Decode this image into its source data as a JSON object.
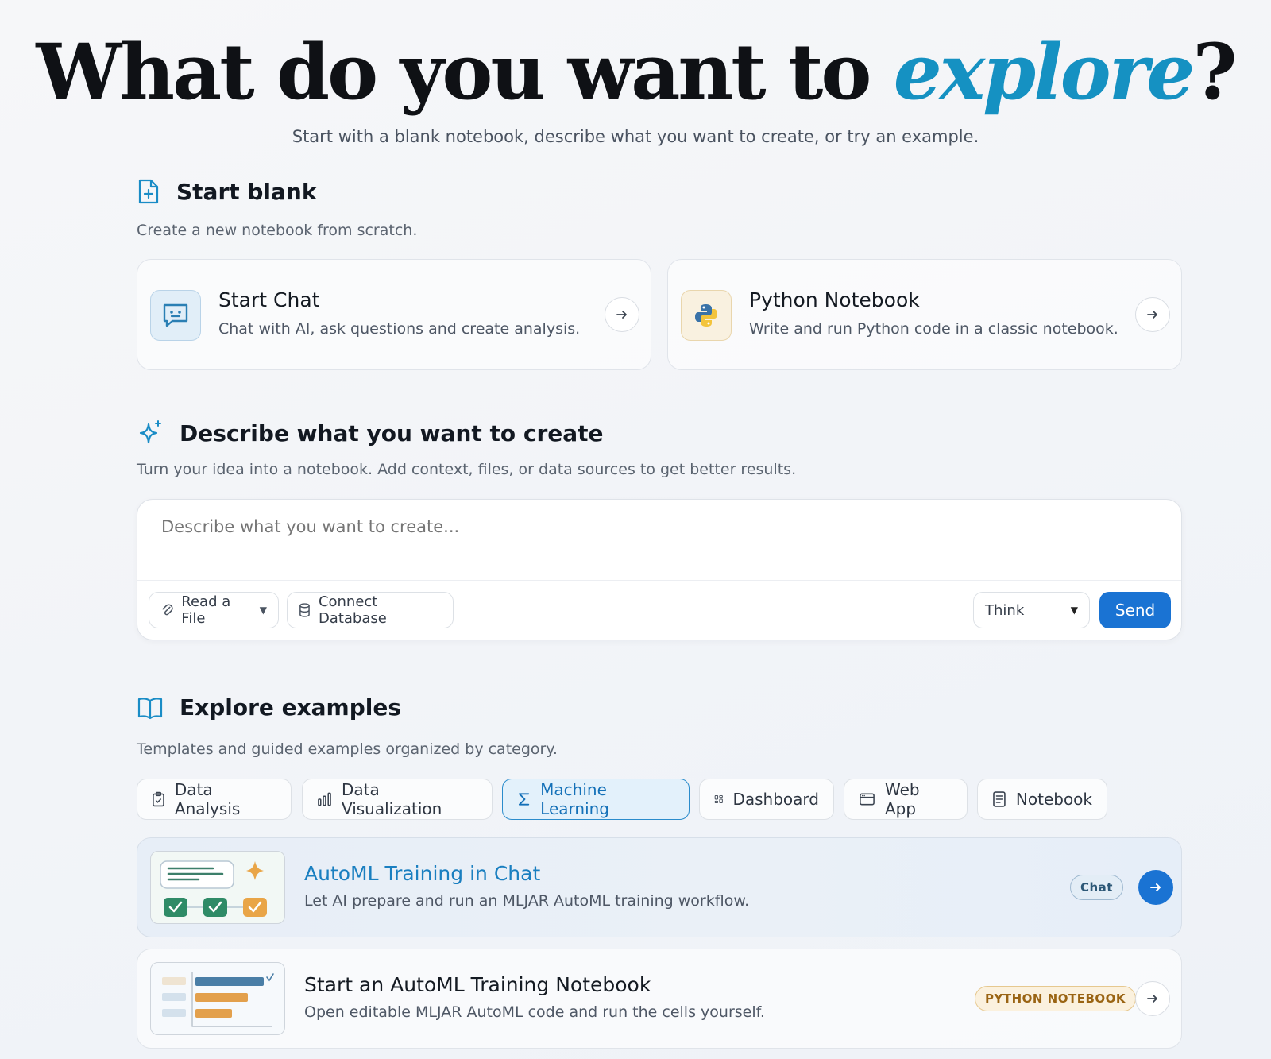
{
  "hero": {
    "title_main": "What do you want to ",
    "title_accent": "explore",
    "title_end": "?",
    "subtitle": "Start with a blank notebook, describe what you want to create, or try an example."
  },
  "start_blank": {
    "heading": "Start blank",
    "description": "Create a new notebook from scratch.",
    "cards": [
      {
        "title": "Start Chat",
        "description": "Chat with AI, ask questions and create analysis.",
        "icon": "chat-bubble-icon"
      },
      {
        "title": "Python Notebook",
        "description": "Write and run Python code in a classic notebook.",
        "icon": "python-icon"
      }
    ]
  },
  "describe": {
    "heading": "Describe what you want to create",
    "description": "Turn your idea into a notebook. Add context, files, or data sources to get better results.",
    "placeholder": "Describe what you want to create...",
    "value": "",
    "read_file_label": "Read a File",
    "connect_db_label": "Connect Database",
    "mode_selected": "Think",
    "send_label": "Send"
  },
  "examples": {
    "heading": "Explore examples",
    "description": "Templates and guided examples organized by category.",
    "tabs": [
      {
        "label": "Data Analysis",
        "icon": "clipboard-icon"
      },
      {
        "label": "Data Visualization",
        "icon": "bar-chart-icon"
      },
      {
        "label": "Machine Learning",
        "icon": "sigma-icon",
        "active": true
      },
      {
        "label": "Dashboard",
        "icon": "dashboard-grid-icon"
      },
      {
        "label": "Web App",
        "icon": "browser-window-icon"
      },
      {
        "label": "Notebook",
        "icon": "document-icon"
      }
    ],
    "items": [
      {
        "title": "AutoML Training in Chat",
        "description": "Let AI prepare and run an MLJAR AutoML training workflow.",
        "badge": "Chat",
        "active": true
      },
      {
        "title": "Start an AutoML Training Notebook",
        "description": "Open editable MLJAR AutoML code and run the cells yourself.",
        "badge": "PYTHON NOTEBOOK"
      }
    ]
  },
  "colors": {
    "accent": "#1591c2",
    "primary_button": "#1a73d3",
    "active_tab_bg": "#e3f1fb",
    "python_badge": "#9a6413"
  }
}
